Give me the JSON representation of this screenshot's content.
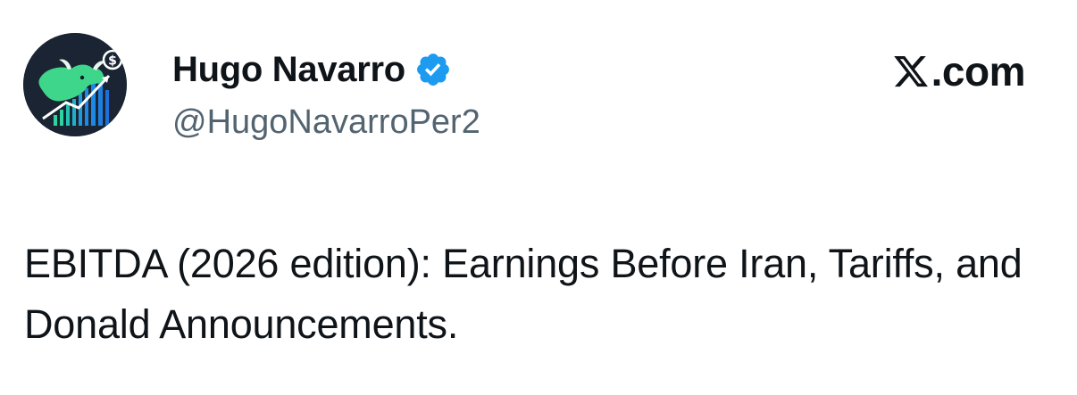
{
  "author": {
    "display_name": "Hugo Navarro",
    "handle": "@HugoNavarroPer2",
    "verified": true,
    "avatar_icon": "bull-chart-dollar-icon",
    "verified_icon": "verified-badge-icon"
  },
  "brand": {
    "logo_icon": "x-logo-icon",
    "suffix": ".com"
  },
  "tweet": {
    "text": "EBITDA (2026 edition): Earnings Before Iran, Tariffs, and Donald Announcements."
  },
  "colors": {
    "text_primary": "#0f1419",
    "text_secondary": "#536471",
    "verified_blue": "#1d9bf0",
    "avatar_background": "#1b2433"
  }
}
